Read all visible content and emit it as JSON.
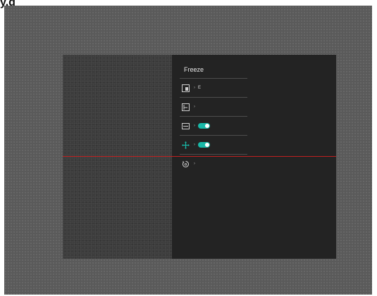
{
  "page_title": "y.g",
  "menu": {
    "title": "Freeze",
    "items": [
      {
        "icon": "display-mode-icon",
        "value": "E",
        "toggle": null
      },
      {
        "icon": "pip-frame-icon",
        "value": "",
        "toggle": null
      },
      {
        "icon": "zoom-width-icon",
        "value": "",
        "toggle": "on"
      },
      {
        "icon": "move-crosshair-icon",
        "value": "",
        "toggle": "on"
      },
      {
        "icon": "reset-rotate-icon",
        "value": "",
        "toggle": null
      }
    ],
    "chevron": "›"
  },
  "colors": {
    "accent": "#18b9a8",
    "panel": "#232323",
    "reticle_line": "#c02020",
    "background": "#5a5a5a"
  }
}
